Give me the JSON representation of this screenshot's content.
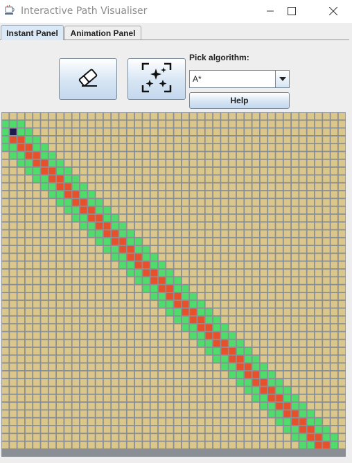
{
  "window": {
    "title": "Interactive Path Visualiser",
    "controls": [
      "minimize-icon",
      "maximize-icon",
      "close-icon"
    ]
  },
  "tabs": [
    {
      "label": "Instant Panel",
      "active": true
    },
    {
      "label": "Animation Panel",
      "active": false
    }
  ],
  "toolbar": {
    "clear_button_icon": "eraser-icon",
    "generate_button_icon": "sparkles-icon",
    "algorithm_label": "Pick algorithm:",
    "algorithm_selected": "A*",
    "help_label": "Help"
  },
  "colors": {
    "empty": "#dcc78b",
    "grid_line": "#8a8f96",
    "visited": "#4fdc6a",
    "path": "#e8502a",
    "start": "#1f1b4a",
    "accent": "#d6e5f3"
  },
  "grid": {
    "cols": 44,
    "rows": 43,
    "start": [
      1,
      2
    ],
    "end": [
      41,
      42
    ],
    "legend": [
      "start",
      "path",
      "visited",
      "empty"
    ]
  }
}
